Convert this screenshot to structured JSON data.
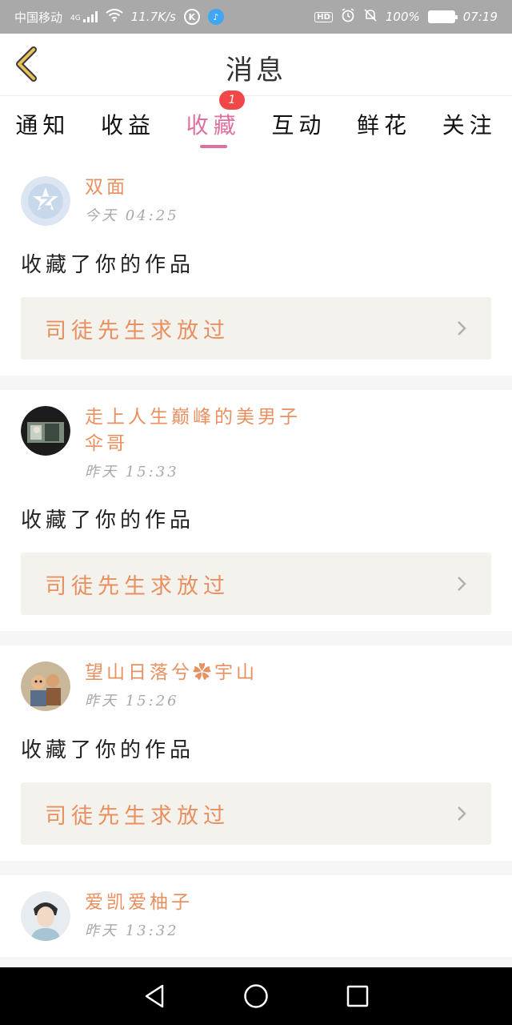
{
  "status_bar": {
    "carrier": "中国移动",
    "network": "4G",
    "speed": "11.7K/s",
    "hd": "HD",
    "battery": "100%",
    "time": "07:19"
  },
  "header": {
    "title": "消息"
  },
  "tabs": [
    {
      "label": "通知"
    },
    {
      "label": "收益"
    },
    {
      "label": "收藏",
      "badge": "1"
    },
    {
      "label": "互动"
    },
    {
      "label": "鲜花"
    },
    {
      "label": "关注"
    }
  ],
  "active_tab": "收藏",
  "colors": {
    "accent_pink": "#e070a0",
    "name_orange": "#e89060",
    "badge_red": "#f04848"
  },
  "messages": [
    {
      "user": "双面",
      "time": "今天 04:25",
      "action": "收藏了你的作品",
      "work": "司徒先生求放过",
      "avatar_icon": "default-avatar-icon"
    },
    {
      "user": "走上人生巅峰的美男子伞哥",
      "time": "昨天 15:33",
      "action": "收藏了你的作品",
      "work": "司徒先生求放过",
      "avatar_icon": "photo-avatar"
    },
    {
      "user": "望山日落兮✿宇山",
      "time": "昨天 15:26",
      "action": "收藏了你的作品",
      "work": "司徒先生求放过",
      "avatar_icon": "cartoon-avatar"
    },
    {
      "user": "爱凯爱柚子",
      "time": "昨天 13:32",
      "avatar_icon": "photo-avatar"
    }
  ]
}
